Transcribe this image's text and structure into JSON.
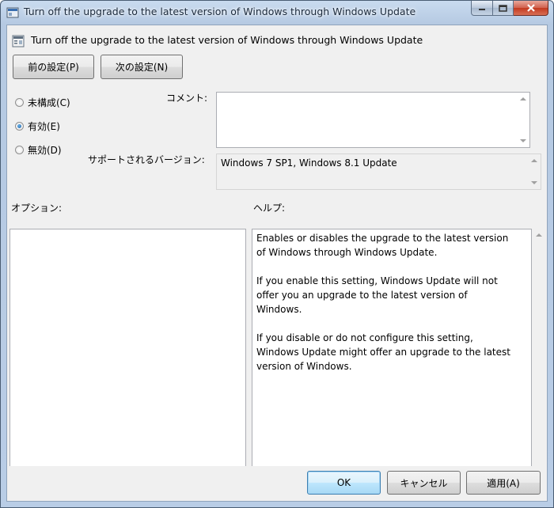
{
  "window": {
    "title": "Turn off the upgrade to the latest version of Windows through Windows Update"
  },
  "policy": {
    "title": "Turn off the upgrade to the latest version of Windows through Windows Update"
  },
  "nav": {
    "prev_label": "前の設定(P)",
    "next_label": "次の設定(N)"
  },
  "state": {
    "options": [
      {
        "label": "未構成(C)",
        "selected": false
      },
      {
        "label": "有効(E)",
        "selected": true
      },
      {
        "label": "無効(D)",
        "selected": false
      }
    ]
  },
  "comment": {
    "label": "コメント:",
    "value": ""
  },
  "supported": {
    "label": "サポートされるバージョン:",
    "value": "Windows 7 SP1, Windows 8.1 Update"
  },
  "options_panel": {
    "label": "オプション:"
  },
  "help_panel": {
    "label": "ヘルプ:",
    "paragraphs": [
      "Enables or disables the upgrade to the latest version of Windows through Windows Update.",
      "If you enable this setting, Windows Update will not offer you an upgrade to the latest version of Windows.",
      "If you disable or do not configure this setting, Windows Update might offer an upgrade to the latest version of Windows."
    ]
  },
  "footer": {
    "ok_label": "OK",
    "cancel_label": "キャンセル",
    "apply_label": "適用(A)"
  },
  "colors": {
    "accent": "#3c7fb1",
    "close_button": "#c3391f"
  }
}
